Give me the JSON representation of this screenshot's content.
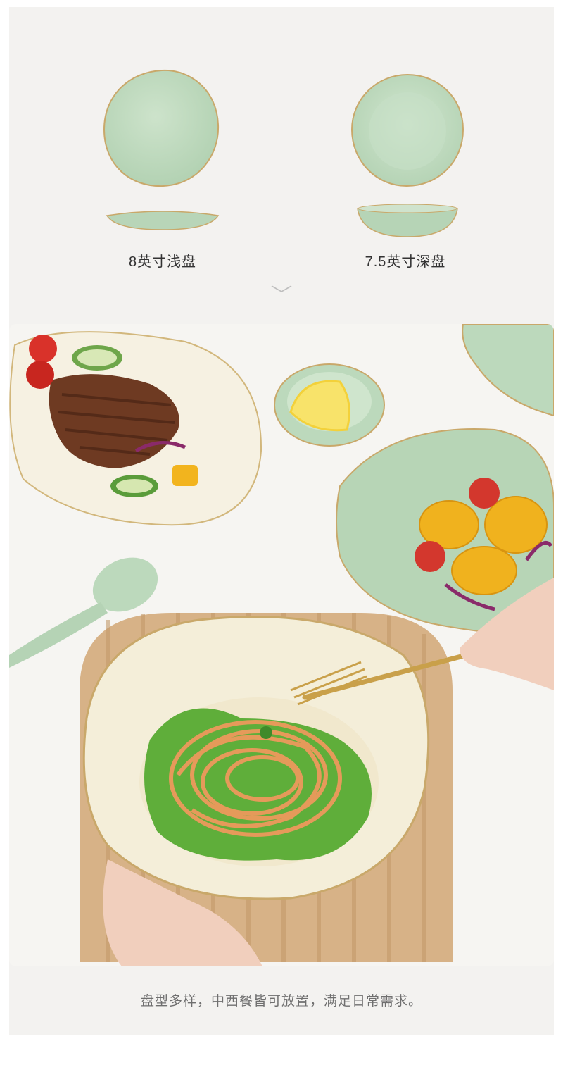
{
  "plates": {
    "shallow_label": "8英寸浅盘",
    "deep_label": "7.5英寸深盘"
  },
  "caption": "盘型多样，中西餐皆可放置，满足日常需求。",
  "colors": {
    "plate_green": "#bcd8bc",
    "gold_rim": "#c9a86a",
    "cream_plate": "#f6f2e4",
    "wood": "#d8b48a"
  },
  "icons": {
    "scroll_hint": "chevron-down-icon"
  }
}
